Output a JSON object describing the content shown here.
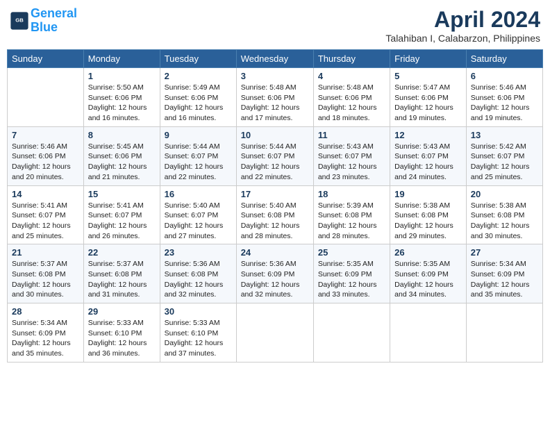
{
  "header": {
    "logo_line1": "General",
    "logo_line2": "Blue",
    "month_title": "April 2024",
    "location": "Talahiban I, Calabarzon, Philippines"
  },
  "weekdays": [
    "Sunday",
    "Monday",
    "Tuesday",
    "Wednesday",
    "Thursday",
    "Friday",
    "Saturday"
  ],
  "weeks": [
    [
      {
        "day": "",
        "info": ""
      },
      {
        "day": "1",
        "info": "Sunrise: 5:50 AM\nSunset: 6:06 PM\nDaylight: 12 hours\nand 16 minutes."
      },
      {
        "day": "2",
        "info": "Sunrise: 5:49 AM\nSunset: 6:06 PM\nDaylight: 12 hours\nand 16 minutes."
      },
      {
        "day": "3",
        "info": "Sunrise: 5:48 AM\nSunset: 6:06 PM\nDaylight: 12 hours\nand 17 minutes."
      },
      {
        "day": "4",
        "info": "Sunrise: 5:48 AM\nSunset: 6:06 PM\nDaylight: 12 hours\nand 18 minutes."
      },
      {
        "day": "5",
        "info": "Sunrise: 5:47 AM\nSunset: 6:06 PM\nDaylight: 12 hours\nand 19 minutes."
      },
      {
        "day": "6",
        "info": "Sunrise: 5:46 AM\nSunset: 6:06 PM\nDaylight: 12 hours\nand 19 minutes."
      }
    ],
    [
      {
        "day": "7",
        "info": "Sunrise: 5:46 AM\nSunset: 6:06 PM\nDaylight: 12 hours\nand 20 minutes."
      },
      {
        "day": "8",
        "info": "Sunrise: 5:45 AM\nSunset: 6:06 PM\nDaylight: 12 hours\nand 21 minutes."
      },
      {
        "day": "9",
        "info": "Sunrise: 5:44 AM\nSunset: 6:07 PM\nDaylight: 12 hours\nand 22 minutes."
      },
      {
        "day": "10",
        "info": "Sunrise: 5:44 AM\nSunset: 6:07 PM\nDaylight: 12 hours\nand 22 minutes."
      },
      {
        "day": "11",
        "info": "Sunrise: 5:43 AM\nSunset: 6:07 PM\nDaylight: 12 hours\nand 23 minutes."
      },
      {
        "day": "12",
        "info": "Sunrise: 5:43 AM\nSunset: 6:07 PM\nDaylight: 12 hours\nand 24 minutes."
      },
      {
        "day": "13",
        "info": "Sunrise: 5:42 AM\nSunset: 6:07 PM\nDaylight: 12 hours\nand 25 minutes."
      }
    ],
    [
      {
        "day": "14",
        "info": "Sunrise: 5:41 AM\nSunset: 6:07 PM\nDaylight: 12 hours\nand 25 minutes."
      },
      {
        "day": "15",
        "info": "Sunrise: 5:41 AM\nSunset: 6:07 PM\nDaylight: 12 hours\nand 26 minutes."
      },
      {
        "day": "16",
        "info": "Sunrise: 5:40 AM\nSunset: 6:07 PM\nDaylight: 12 hours\nand 27 minutes."
      },
      {
        "day": "17",
        "info": "Sunrise: 5:40 AM\nSunset: 6:08 PM\nDaylight: 12 hours\nand 28 minutes."
      },
      {
        "day": "18",
        "info": "Sunrise: 5:39 AM\nSunset: 6:08 PM\nDaylight: 12 hours\nand 28 minutes."
      },
      {
        "day": "19",
        "info": "Sunrise: 5:38 AM\nSunset: 6:08 PM\nDaylight: 12 hours\nand 29 minutes."
      },
      {
        "day": "20",
        "info": "Sunrise: 5:38 AM\nSunset: 6:08 PM\nDaylight: 12 hours\nand 30 minutes."
      }
    ],
    [
      {
        "day": "21",
        "info": "Sunrise: 5:37 AM\nSunset: 6:08 PM\nDaylight: 12 hours\nand 30 minutes."
      },
      {
        "day": "22",
        "info": "Sunrise: 5:37 AM\nSunset: 6:08 PM\nDaylight: 12 hours\nand 31 minutes."
      },
      {
        "day": "23",
        "info": "Sunrise: 5:36 AM\nSunset: 6:08 PM\nDaylight: 12 hours\nand 32 minutes."
      },
      {
        "day": "24",
        "info": "Sunrise: 5:36 AM\nSunset: 6:09 PM\nDaylight: 12 hours\nand 32 minutes."
      },
      {
        "day": "25",
        "info": "Sunrise: 5:35 AM\nSunset: 6:09 PM\nDaylight: 12 hours\nand 33 minutes."
      },
      {
        "day": "26",
        "info": "Sunrise: 5:35 AM\nSunset: 6:09 PM\nDaylight: 12 hours\nand 34 minutes."
      },
      {
        "day": "27",
        "info": "Sunrise: 5:34 AM\nSunset: 6:09 PM\nDaylight: 12 hours\nand 35 minutes."
      }
    ],
    [
      {
        "day": "28",
        "info": "Sunrise: 5:34 AM\nSunset: 6:09 PM\nDaylight: 12 hours\nand 35 minutes."
      },
      {
        "day": "29",
        "info": "Sunrise: 5:33 AM\nSunset: 6:10 PM\nDaylight: 12 hours\nand 36 minutes."
      },
      {
        "day": "30",
        "info": "Sunrise: 5:33 AM\nSunset: 6:10 PM\nDaylight: 12 hours\nand 37 minutes."
      },
      {
        "day": "",
        "info": ""
      },
      {
        "day": "",
        "info": ""
      },
      {
        "day": "",
        "info": ""
      },
      {
        "day": "",
        "info": ""
      }
    ]
  ]
}
